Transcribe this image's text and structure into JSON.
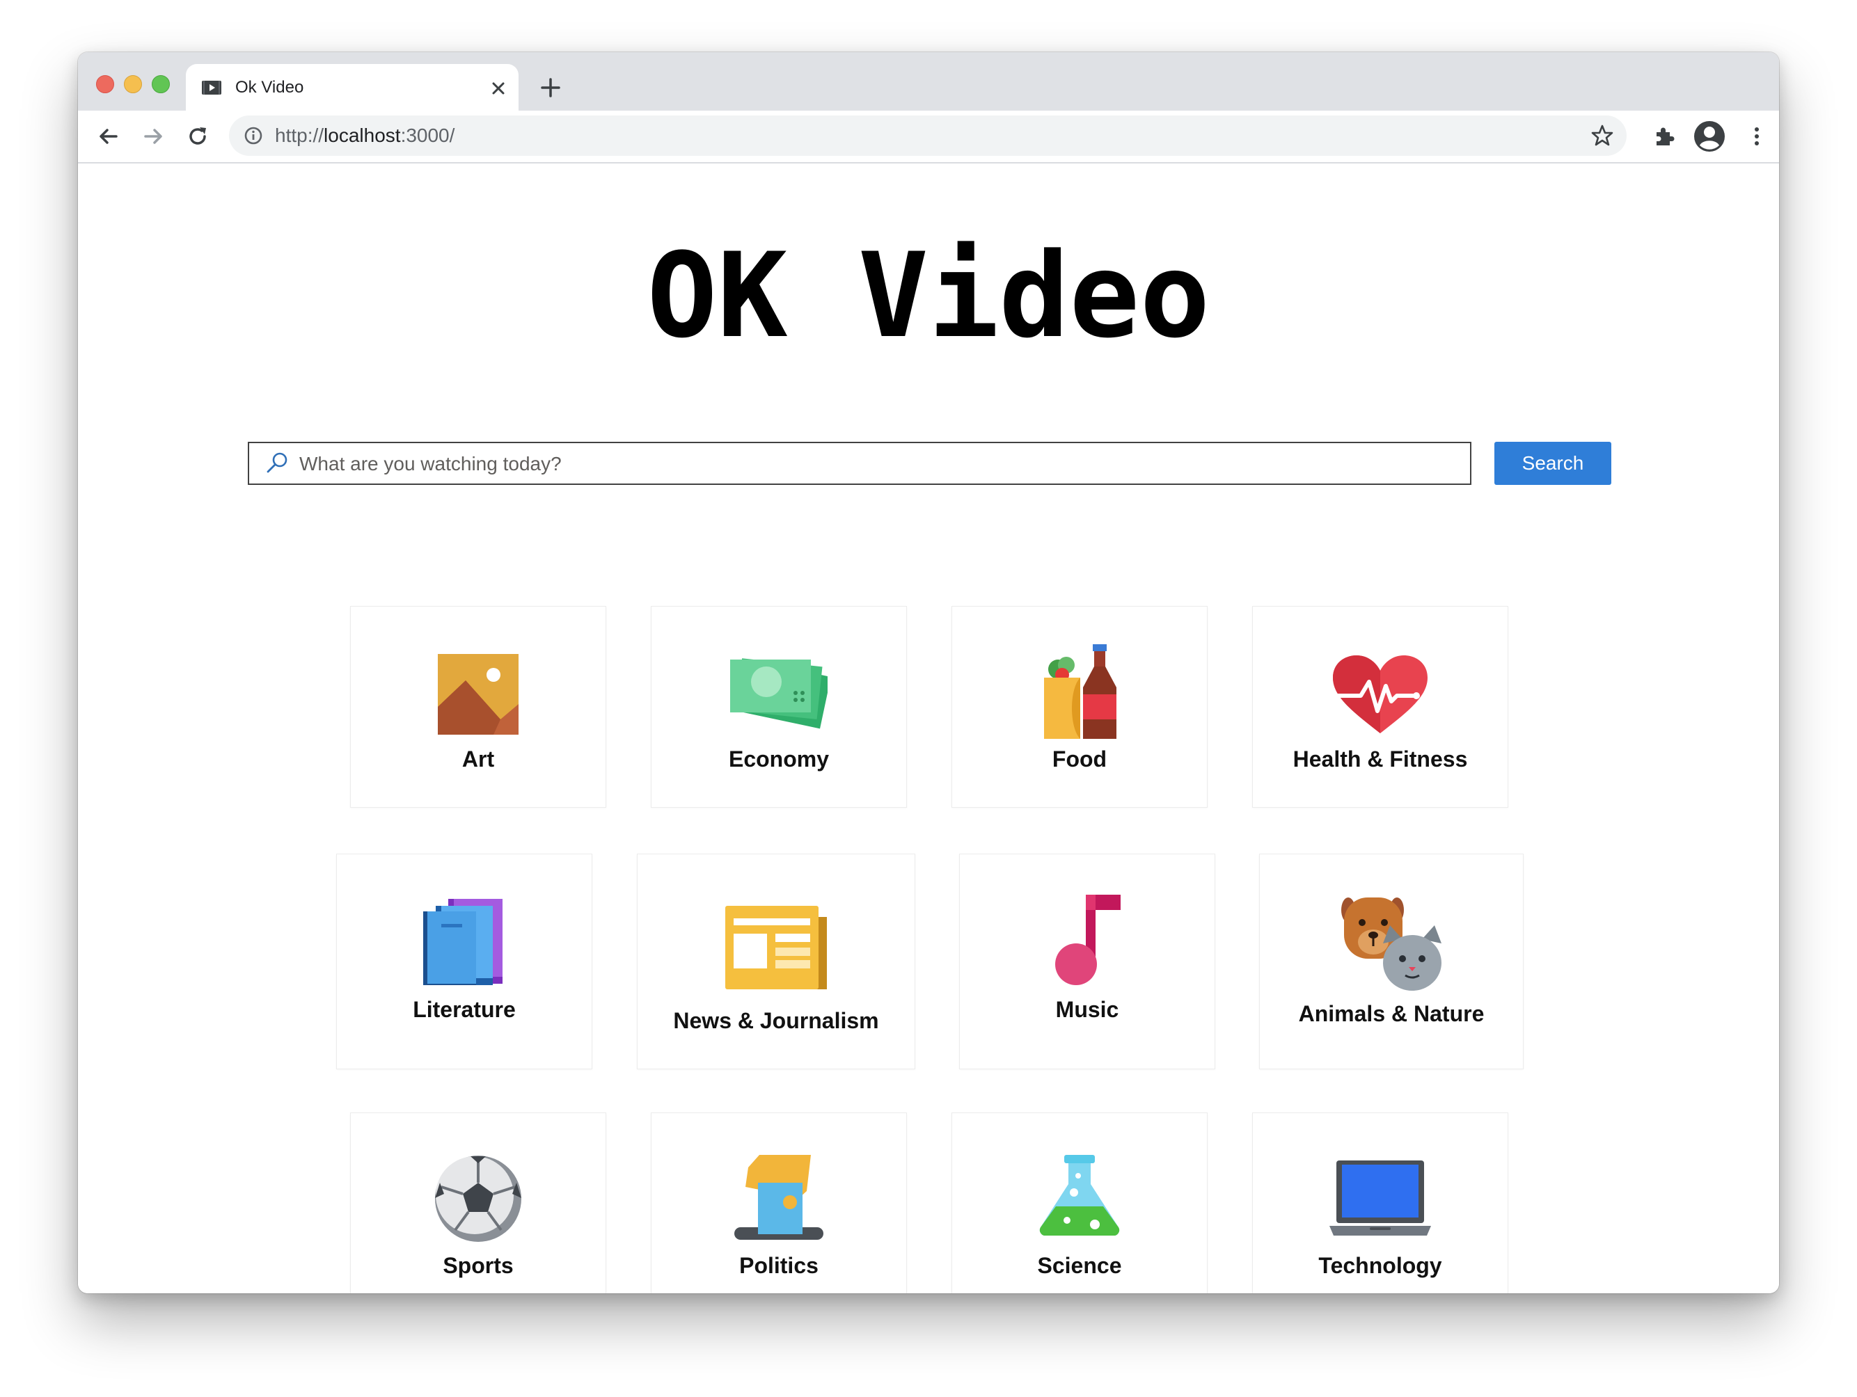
{
  "browser": {
    "tab_title": "Ok Video",
    "url_scheme": "http://",
    "url_host": "localhost",
    "url_rest": ":3000/",
    "colors": {
      "close": "#ed6a5e",
      "minimize": "#f5bf4f",
      "maximize": "#61c554"
    }
  },
  "page": {
    "title": "OK Video",
    "search": {
      "placeholder": "What are you watching today?",
      "value": "",
      "button_label": "Search",
      "accent": "#2f7ed8"
    },
    "categories": [
      {
        "label": "Art",
        "icon": "picture-icon"
      },
      {
        "label": "Economy",
        "icon": "money-icon"
      },
      {
        "label": "Food",
        "icon": "food-drink-icon"
      },
      {
        "label": "Health & Fitness",
        "icon": "heartbeat-icon"
      },
      {
        "label": "Literature",
        "icon": "books-icon"
      },
      {
        "label": "News & Journalism",
        "icon": "newspaper-icon"
      },
      {
        "label": "Music",
        "icon": "music-note-icon"
      },
      {
        "label": "Animals & Nature",
        "icon": "dog-cat-icon"
      },
      {
        "label": "Sports",
        "icon": "soccer-ball-icon"
      },
      {
        "label": "Politics",
        "icon": "ballot-icon"
      },
      {
        "label": "Science",
        "icon": "flask-icon"
      },
      {
        "label": "Technology",
        "icon": "laptop-icon"
      }
    ]
  }
}
